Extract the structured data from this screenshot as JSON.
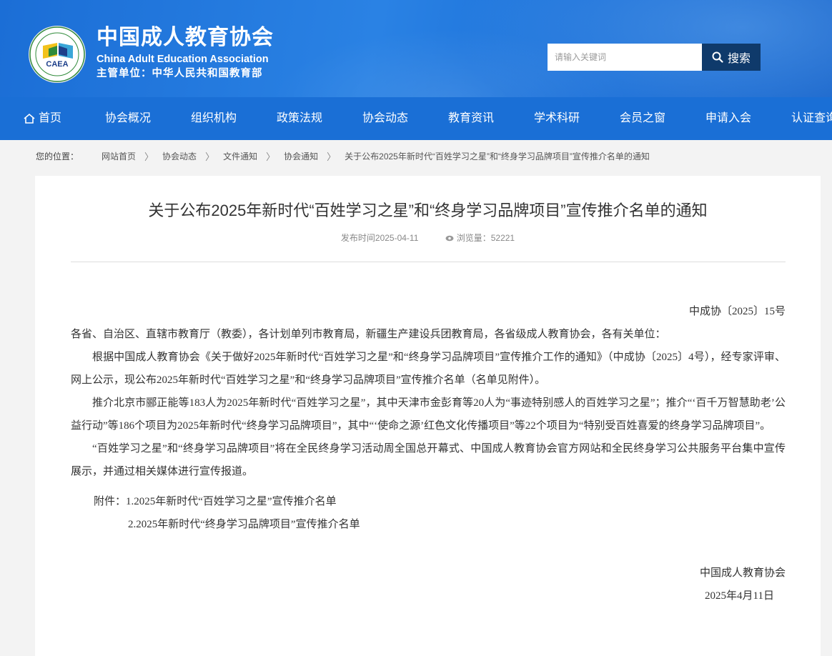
{
  "header": {
    "logo_text": "CAEA",
    "logo_ring_text": "CHINA ADULT EDUCATION ASSOCIATION 中国成人教育协会",
    "site_title": "中国成人教育协会",
    "site_title_en": "China Adult Education Association",
    "site_subtitle": "主管单位：中华人民共和国教育部",
    "search_placeholder": "请输入关键词",
    "search_button": "搜索",
    "colors": {
      "header_blue": "#1a6fd6",
      "search_button_bg": "#0f3a6b"
    }
  },
  "nav": {
    "items": [
      "首页",
      "协会概况",
      "组织机构",
      "政策法规",
      "协会动态",
      "教育资讯",
      "学术科研",
      "会员之窗",
      "申请入会",
      "认证查询"
    ]
  },
  "breadcrumb": {
    "label": "您的位置：",
    "items": [
      "网站首页",
      "协会动态",
      "文件通知",
      "协会通知",
      "关于公布2025年新时代“百姓学习之星”和“终身学习品牌项目”宣传推介名单的通知"
    ]
  },
  "article": {
    "title": "关于公布2025年新时代“百姓学习之星”和“终身学习品牌项目”宣传推介名单的通知",
    "publish_time": "发布时间2025-04-11",
    "views": "浏览量：52221",
    "doc_number": "中成协〔2025〕15号",
    "salutation": "各省、自治区、直辖市教育厅（教委），各计划单列市教育局，新疆生产建设兵团教育局，各省级成人教育协会，各有关单位：",
    "paragraphs": [
      "根据中国成人教育协会《关于做好2025年新时代“百姓学习之星”和“终身学习品牌项目”宣传推介工作的通知》（中成协〔2025〕4号），经专家评审、网上公示，现公布2025年新时代“百姓学习之星”和“终身学习品牌项目”宣传推介名单（名单见附件）。",
      "推介北京市郦正能等183人为2025年新时代“百姓学习之星”，其中天津市金彭育等20人为“事迹特别感人的百姓学习之星”；推介“‘百千万智慧助老’公益行动”等186个项目为2025年新时代“终身学习品牌项目”，其中“‘使命之源’红色文化传播项目”等22个项目为“特别受百姓喜爱的终身学习品牌项目”。",
      "“百姓学习之星”和“终身学习品牌项目”将在全民终身学习活动周全国总开幕式、中国成人教育协会官方网站和全民终身学习公共服务平台集中宣传展示，并通过相关媒体进行宣传报道。"
    ],
    "attachment_1": "附件：1.2025年新时代“百姓学习之星”宣传推介名单",
    "attachment_2": "2.2025年新时代“终身学习品牌项目”宣传推介名单",
    "signature": "中国成人教育协会",
    "date": "2025年4月11日"
  }
}
